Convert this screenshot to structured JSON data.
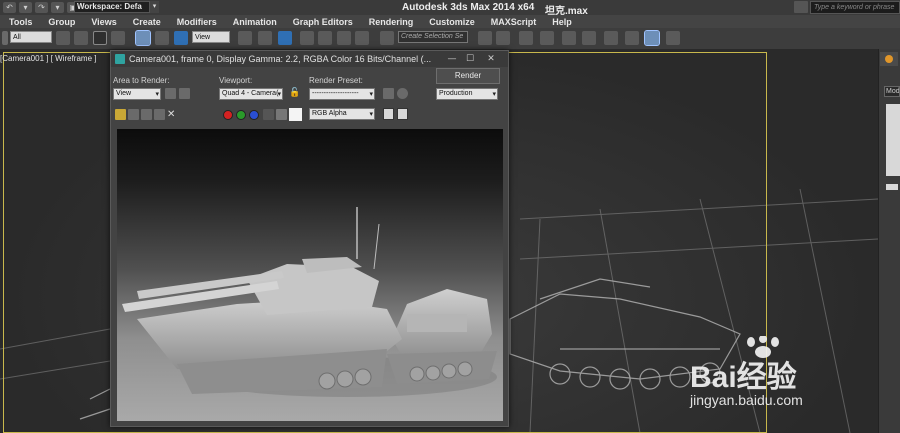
{
  "titlebar": {
    "workspace_label": "Workspace: Defa",
    "app_title": "Autodesk 3ds Max  2014 x64",
    "file_name": "坦克.max",
    "search_placeholder": "Type a keyword or phrase"
  },
  "menubar": {
    "items": [
      "Tools",
      "Group",
      "Views",
      "Create",
      "Modifiers",
      "Animation",
      "Graph Editors",
      "Rendering",
      "Customize",
      "MAXScript",
      "Help"
    ]
  },
  "toolbar": {
    "selection_filter": "All",
    "reference_coord": "View",
    "named_selection_set": "Create Selection Se"
  },
  "viewport": {
    "label": "[Camera001 ] [ Wireframe ]",
    "border_color": "#c8b84c"
  },
  "command_panel": {
    "field_text": "Mod"
  },
  "render_frame": {
    "title": "Camera001, frame 0, Display Gamma: 2.2, RGBA Color 16 Bits/Channel (...",
    "area_to_render_label": "Area to Render:",
    "area_to_render_value": "View",
    "viewport_label": "Viewport:",
    "viewport_value": "Quad 4 - Camera(",
    "render_preset_label": "Render Preset:",
    "render_preset_value": "--------------------",
    "render_button": "Render",
    "production_value": "Production",
    "channel_value": "RGB Alpha",
    "swatch_colors": [
      "#d42222",
      "#2a9a2a",
      "#2a4fd4"
    ]
  },
  "watermark": {
    "brand": "Bai经验",
    "url": "jingyan.baidu.com"
  }
}
